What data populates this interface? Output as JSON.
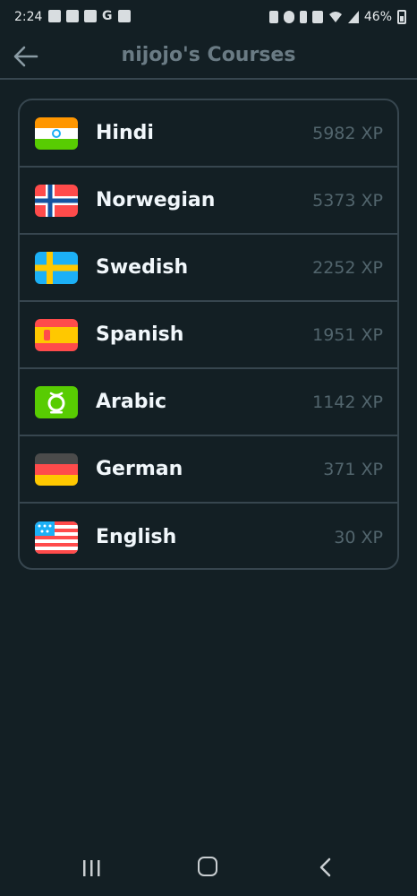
{
  "status_bar": {
    "time": "2:24",
    "battery": "46%"
  },
  "header": {
    "title": "nijojo's Courses"
  },
  "courses": [
    {
      "name": "Hindi",
      "xp": "5982 XP",
      "flag": "india-flag-icon"
    },
    {
      "name": "Norwegian",
      "xp": "5373 XP",
      "flag": "norway-flag-icon"
    },
    {
      "name": "Swedish",
      "xp": "2252 XP",
      "flag": "sweden-flag-icon"
    },
    {
      "name": "Spanish",
      "xp": "1951 XP",
      "flag": "spain-flag-icon"
    },
    {
      "name": "Arabic",
      "xp": "1142 XP",
      "flag": "arabic-flag-icon"
    },
    {
      "name": "German",
      "xp": "371 XP",
      "flag": "germany-flag-icon"
    },
    {
      "name": "English",
      "xp": "30 XP",
      "flag": "usa-flag-icon"
    }
  ],
  "colors": {
    "background": "#131F24",
    "border": "#37464F",
    "title": "#6A7B84",
    "course_name": "#F1F7FB",
    "xp": "#52656D"
  }
}
